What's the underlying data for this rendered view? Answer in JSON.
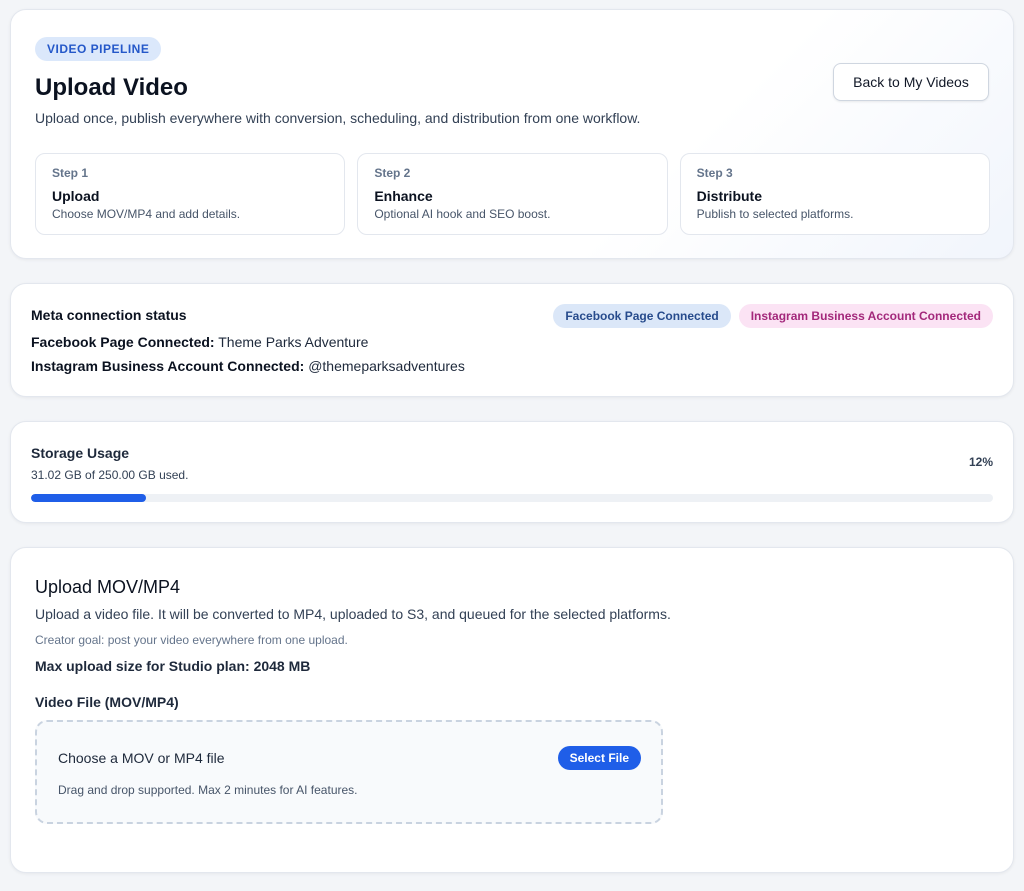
{
  "hero": {
    "tag": "VIDEO PIPELINE",
    "title": "Upload Video",
    "subtitle": "Upload once, publish everywhere with conversion, scheduling, and distribution from one workflow.",
    "back_button": "Back to My Videos",
    "steps": [
      {
        "num": "Step 1",
        "title": "Upload",
        "desc": "Choose MOV/MP4 and add details."
      },
      {
        "num": "Step 2",
        "title": "Enhance",
        "desc": "Optional AI hook and SEO boost."
      },
      {
        "num": "Step 3",
        "title": "Distribute",
        "desc": "Publish to selected platforms."
      }
    ]
  },
  "meta": {
    "title": "Meta connection status",
    "facebook_label": "Facebook Page Connected:",
    "facebook_value": "Theme Parks Adventure",
    "instagram_label": "Instagram Business Account Connected:",
    "instagram_value": "@themeparksadventures",
    "badges": {
      "facebook": "Facebook Page Connected",
      "instagram": "Instagram Business Account Connected"
    }
  },
  "storage": {
    "title": "Storage Usage",
    "detail": "31.02 GB of 250.00 GB used.",
    "percent_label": "12%",
    "percent": 12
  },
  "upload": {
    "title": "Upload MOV/MP4",
    "description": "Upload a video file. It will be converted to MP4, uploaded to S3, and queued for the selected platforms.",
    "goal": "Creator goal: post your video everywhere from one upload.",
    "max_size": "Max upload size for Studio plan: 2048 MB",
    "field_label": "Video File (MOV/MP4)",
    "dropzone_title": "Choose a MOV or MP4 file",
    "dropzone_hint": "Drag and drop supported. Max 2 minutes for AI features.",
    "select_button": "Select File"
  },
  "colors": {
    "accent": "#1f5ee8",
    "facebook_badge_bg": "#dbe7f8",
    "instagram_badge_bg": "#fbe3f4"
  }
}
